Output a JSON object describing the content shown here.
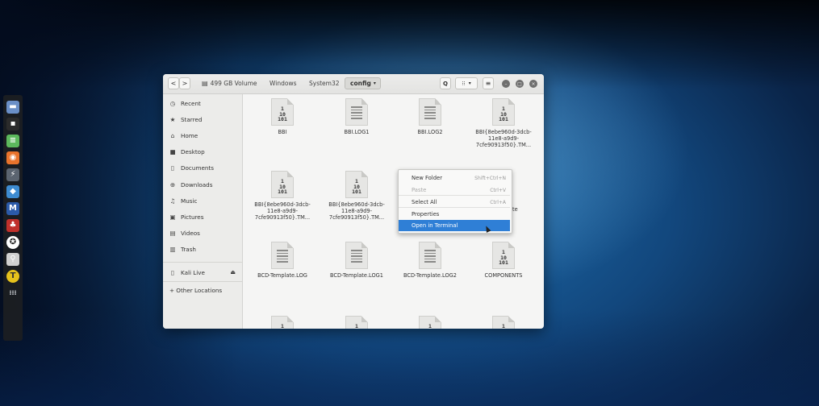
{
  "colors": {
    "accent": "#2f7fd6",
    "window_bg": "#f5f5f4",
    "sidebar_bg": "#ececea",
    "dock_bg": "#1c1e22"
  },
  "dock": {
    "items": [
      {
        "name": "files-app-icon",
        "glyph": "▬",
        "color": "#6a8fc7"
      },
      {
        "name": "terminal-app-icon",
        "glyph": "▪",
        "color": "#2b2b2b"
      },
      {
        "name": "text-editor-icon",
        "glyph": "≡",
        "color": "#5cb85c"
      },
      {
        "name": "firefox-icon",
        "glyph": "◉",
        "color": "#e8732c"
      },
      {
        "name": "burp-suite-icon",
        "glyph": "⚡",
        "color": "#5b6470"
      },
      {
        "name": "eye-tool-icon",
        "glyph": "◆",
        "color": "#3d8bd1"
      },
      {
        "name": "metasploit-icon",
        "glyph": "M",
        "color": "#2b5aa8"
      },
      {
        "name": "cherrytree-icon",
        "glyph": "♣",
        "color": "#c0302b"
      },
      {
        "name": "faraday-icon",
        "glyph": "✪",
        "color": "#ffffff"
      },
      {
        "name": "wifi-tool-icon",
        "glyph": "⚲",
        "color": "#d0d0d0"
      },
      {
        "name": "keyring-icon",
        "glyph": "T",
        "color": "#e6c21c"
      },
      {
        "name": "show-apps-icon",
        "glyph": "⁞⁞⁞",
        "color": "#cfd3d8"
      }
    ]
  },
  "header": {
    "back": "<",
    "forward": ">",
    "volume_label": "499 GB Volume",
    "crumbs": [
      "Windows",
      "System32"
    ],
    "current": "config",
    "current_arrow": "▾",
    "search_glyph": "Q",
    "view_glyph": "⁝⁝",
    "view_arrow": "▾",
    "menu_glyph": "≡",
    "minimize": "–",
    "maximize": "□",
    "close": "×"
  },
  "sidebar": {
    "items": [
      {
        "icon": "◷",
        "label": "Recent"
      },
      {
        "icon": "★",
        "label": "Starred"
      },
      {
        "icon": "⌂",
        "label": "Home"
      },
      {
        "icon": "■",
        "label": "Desktop"
      },
      {
        "icon": "▯",
        "label": "Documents"
      },
      {
        "icon": "⊕",
        "label": "Downloads"
      },
      {
        "icon": "♫",
        "label": "Music"
      },
      {
        "icon": "▣",
        "label": "Pictures"
      },
      {
        "icon": "▤",
        "label": "Videos"
      },
      {
        "icon": "▥",
        "label": "Trash"
      }
    ],
    "kali_live": "Kali Live",
    "eject": "⏏",
    "other": "+ Other Locations"
  },
  "files": [
    {
      "name": "BBI",
      "kind": "binary"
    },
    {
      "name": "BBI.LOG1",
      "kind": "text"
    },
    {
      "name": "BBI.LOG2",
      "kind": "text"
    },
    {
      "name": "BBI{8ebe960d-3dcb-11e8-a9d9-7cfe90913f50}.TM...",
      "kind": "binary"
    },
    {
      "name": "BBI{8ebe960d-3dcb-11e8-a9d9-7cfe90913f50}.TM...",
      "kind": "binary"
    },
    {
      "name": "BBI{8ebe960d-3dcb-11e8-a9d9-7cfe90913f50}.TM...",
      "kind": "binary"
    },
    {
      "name": "plate",
      "kind": "hidden"
    },
    {
      "name": "",
      "kind": "hidden"
    },
    {
      "name": "BCD-Template.LOG",
      "kind": "text"
    },
    {
      "name": "BCD-Template.LOG1",
      "kind": "text"
    },
    {
      "name": "BCD-Template.LOG2",
      "kind": "text"
    },
    {
      "name": "COMPONENTS",
      "kind": "binary"
    },
    {
      "name": "",
      "kind": "binary"
    },
    {
      "name": "",
      "kind": "binary"
    },
    {
      "name": "",
      "kind": "binary"
    },
    {
      "name": "",
      "kind": "binary"
    }
  ],
  "binary_glyph": "1\n10\n101",
  "context_menu": {
    "items": [
      {
        "label": "New Folder",
        "shortcut": "Shift+Ctrl+N",
        "state": "normal"
      },
      {
        "label": "Paste",
        "shortcut": "Ctrl+V",
        "state": "disabled"
      },
      {
        "label": "Select All",
        "shortcut": "Ctrl+A",
        "state": "normal"
      },
      {
        "label": "Properties",
        "shortcut": "",
        "state": "normal"
      },
      {
        "label": "Open in Terminal",
        "shortcut": "",
        "state": "highlighted"
      }
    ]
  }
}
